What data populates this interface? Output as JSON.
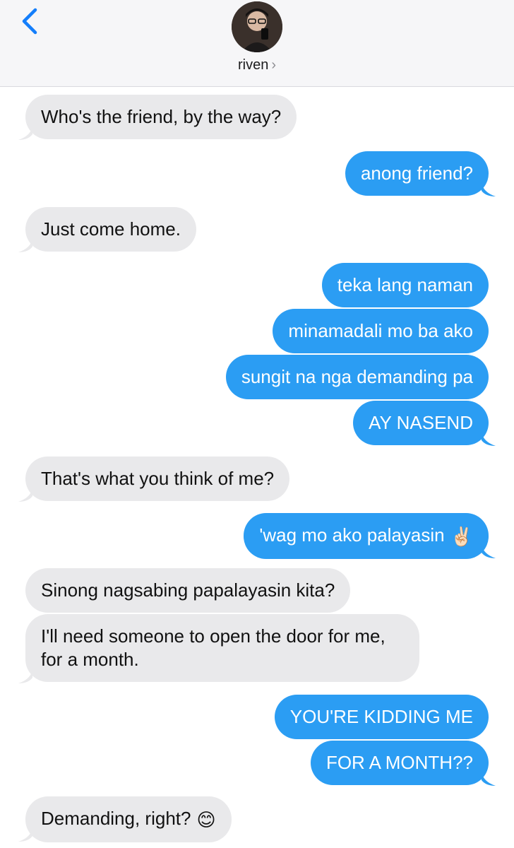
{
  "header": {
    "contact_name": "riven",
    "chevron": "›"
  },
  "icons": {
    "back": "chevron-left-icon",
    "avatar": "contact-photo"
  },
  "colors": {
    "incoming_bubble": "#e9e9eb",
    "outgoing_bubble": "#2b9df3",
    "accent": "#147efb"
  },
  "messages": [
    {
      "dir": "in",
      "text": "Who's the friend, by the way?"
    },
    {
      "dir": "out",
      "text": "anong friend?"
    },
    {
      "dir": "in",
      "text": "Just come home."
    },
    {
      "dir": "out",
      "text": "teka lang naman"
    },
    {
      "dir": "out",
      "text": "minamadali mo ba ako"
    },
    {
      "dir": "out",
      "text": "sungit na nga demanding pa"
    },
    {
      "dir": "out",
      "text": "AY NASEND"
    },
    {
      "dir": "in",
      "text": "That's what you think of me?"
    },
    {
      "dir": "out",
      "text": "'wag mo ako palayasin",
      "emoji": "✌🏻"
    },
    {
      "dir": "in",
      "text": "Sinong nagsabing papalayasin kita?"
    },
    {
      "dir": "in",
      "text": "I'll need someone to open the door for me, for a month."
    },
    {
      "dir": "out",
      "text": "YOU'RE KIDDING ME"
    },
    {
      "dir": "out",
      "text": "FOR A MONTH??"
    },
    {
      "dir": "in",
      "text": "Demanding, right?",
      "emoji": "😊"
    }
  ]
}
